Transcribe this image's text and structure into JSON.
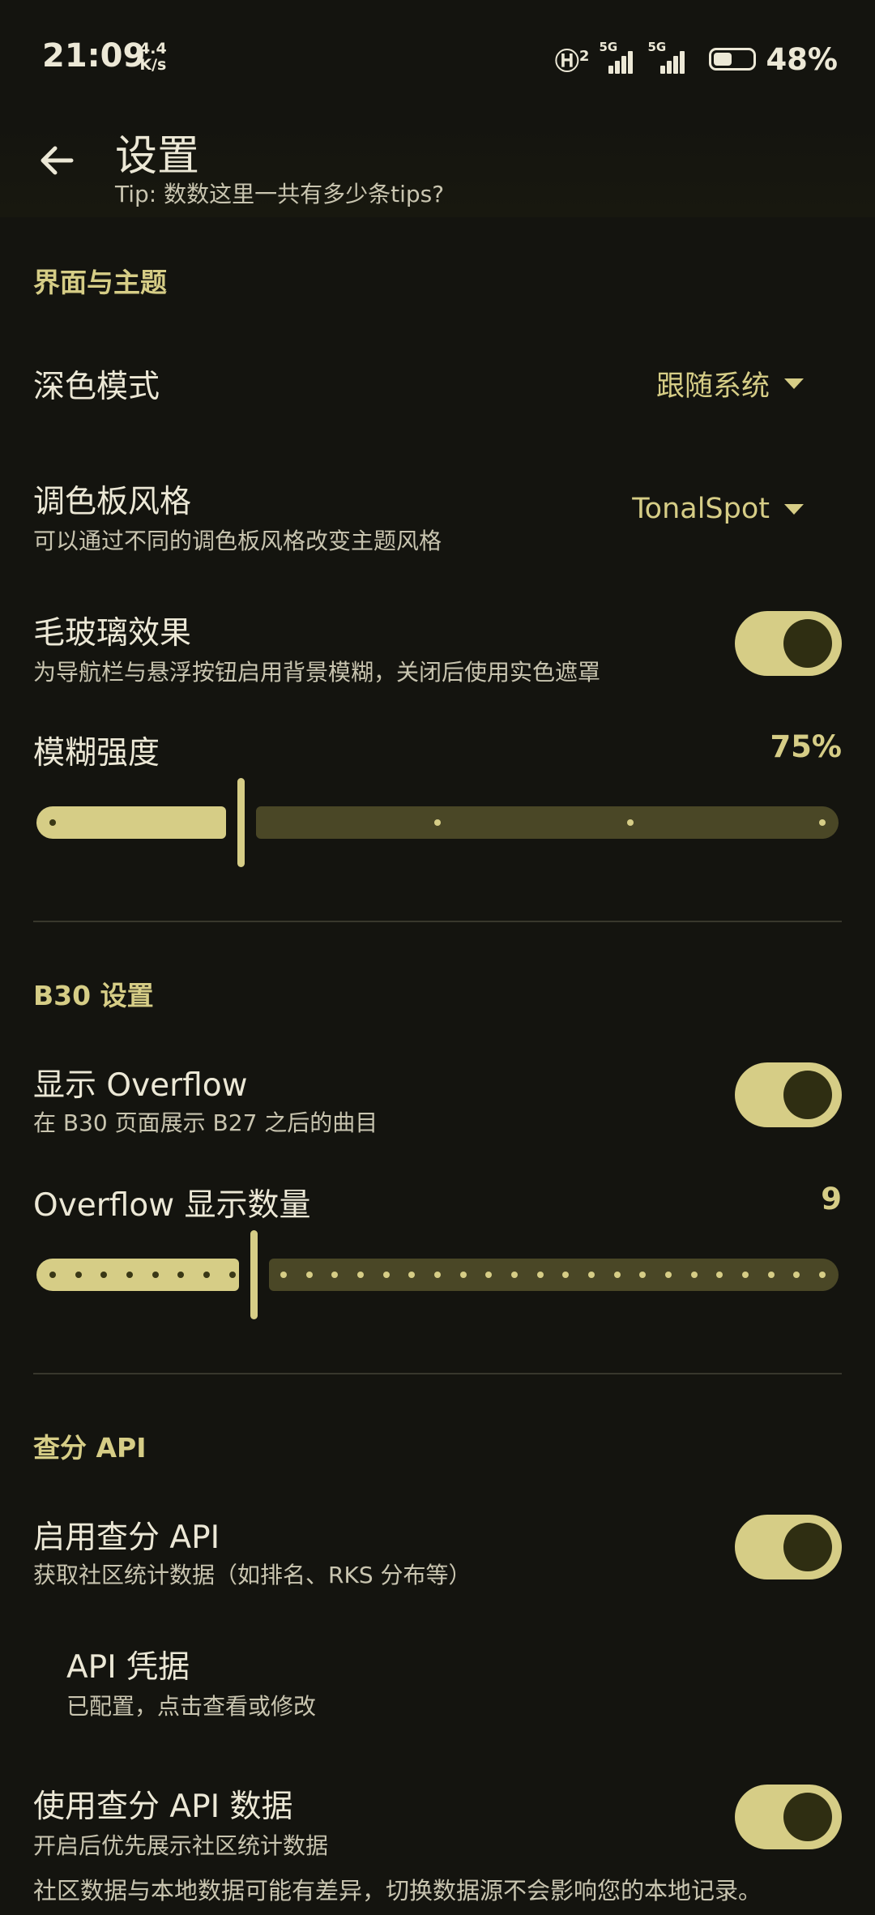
{
  "status_bar": {
    "time": "21:09",
    "net_speed_value": "4.4",
    "net_speed_unit": "K/s",
    "sim1_label": "5G",
    "sim2_label": "5G",
    "hd_label": "2",
    "battery_percent": "48%",
    "battery_level": 0.48
  },
  "header": {
    "title": "设置",
    "tip": "Tip: 数数这里一共有多少条tips?"
  },
  "sections": {
    "theme": {
      "title": "界面与主题",
      "dark_mode": {
        "title": "深色模式",
        "value": "跟随系统"
      },
      "palette": {
        "title": "调色板风格",
        "subtitle": "可以通过不同的调色板风格改变主题风格",
        "value": "TonalSpot"
      },
      "glass": {
        "title": "毛玻璃效果",
        "subtitle": "为导航栏与悬浮按钮启用背景模糊，关闭后使用实色遮罩",
        "enabled": true
      },
      "blur": {
        "title": "模糊强度",
        "value_label": "75%",
        "value": 0.25,
        "steps": 4
      }
    },
    "b30": {
      "title": "B30 设置",
      "show_overflow": {
        "title": "显示 Overflow",
        "subtitle": "在 B30 页面展示 B27 之后的曲目",
        "enabled": true
      },
      "overflow_count": {
        "title": "Overflow 显示数量",
        "value_label": "9",
        "value": 9,
        "min": 1,
        "max": 31
      }
    },
    "api": {
      "title": "查分 API",
      "enable_api": {
        "title": "启用查分 API",
        "subtitle": "获取社区统计数据（如排名、RKS 分布等）",
        "enabled": true
      },
      "credentials": {
        "title": "API 凭据",
        "subtitle": "已配置，点击查看或修改"
      },
      "use_api_data": {
        "title": "使用查分 API 数据",
        "subtitle": "开启后优先展示社区统计数据",
        "enabled": true
      },
      "note": "社区数据与本地数据可能有差异，切换数据源不会影响您的本地记录。"
    }
  },
  "colors": {
    "background": "#14140f",
    "accent": "#d6cd86",
    "accent_dark": "#2f2e12",
    "track_inactive": "#4a4726"
  }
}
